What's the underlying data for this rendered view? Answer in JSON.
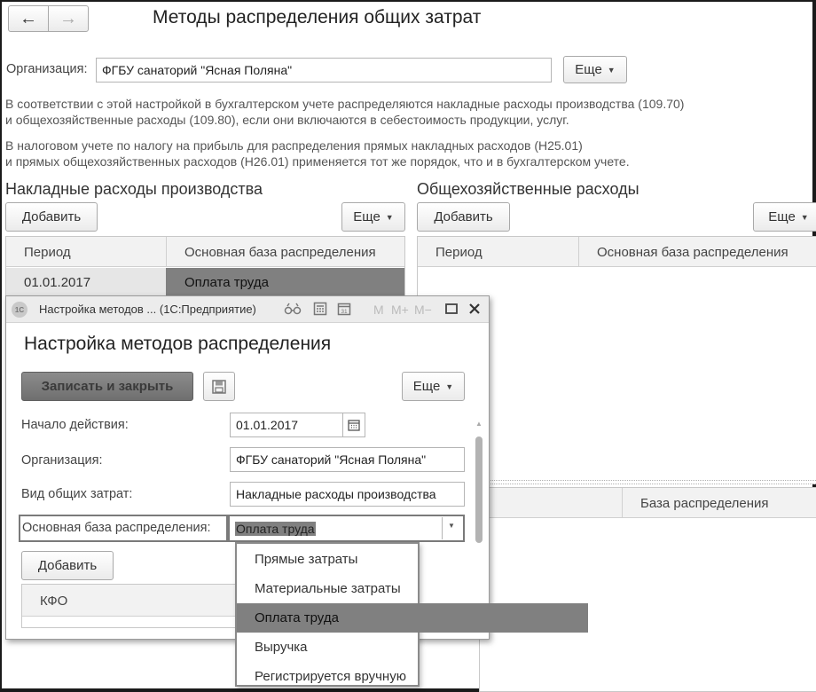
{
  "window": {
    "title": "Методы распределения общих затрат"
  },
  "nav": {
    "back": "←",
    "forward": "→"
  },
  "org": {
    "label": "Организация:",
    "value": "ФГБУ санаторий \"Ясная Поляна\""
  },
  "more_label": "Еще",
  "info1": {
    "line1": "В соответствии с этой настройкой в бухгалтерском учете распределяются накладные расходы производства (109.70)",
    "line2": "и общехозяйственные расходы (109.80), если они включаются в себестоимость продукции, услуг."
  },
  "info2": {
    "line1": "В налоговом учете по налогу на прибыль для распределения прямых накладных расходов (Н25.01)",
    "line2": "и прямых общехозяйственных расходов (Н26.01) применяется тот же порядок, что и в бухгалтерском учете."
  },
  "left_section": {
    "title": "Накладные расходы производства",
    "add": "Добавить",
    "columns": [
      "Период",
      "Основная база распределения"
    ],
    "rows": [
      {
        "period": "01.01.2017",
        "base": "Оплата труда"
      }
    ]
  },
  "right_section": {
    "title": "Общехозяйственные расходы",
    "add": "Добавить",
    "columns": [
      "Период",
      "Основная база распределения"
    ],
    "lower_column": "База распределения"
  },
  "dialog": {
    "window_title": "Настройка методов ... (1С:Предприятие)",
    "app_badge": "1С",
    "tb_m": "M",
    "tb_mplus": "M+",
    "tb_mminus": "M−",
    "heading": "Настройка методов распределения",
    "save_close": "Записать и закрыть",
    "more": "Еще",
    "start_label": "Начало действия:",
    "start_value": "01.01.2017",
    "org_label": "Организация:",
    "org_value": "ФГБУ санаторий \"Ясная Поляна\"",
    "cost_type_label": "Вид общих затрат:",
    "cost_type_value": "Накладные расходы производства",
    "base_label": "Основная база распределения:",
    "base_value": "Оплата труда",
    "add": "Добавить",
    "kfo_column": "КФО"
  },
  "dropdown": {
    "items": [
      "Прямые затраты",
      "Материальные затраты",
      "Оплата труда",
      "Выручка",
      "Регистрируется вручную"
    ],
    "selected": "Оплата труда"
  }
}
